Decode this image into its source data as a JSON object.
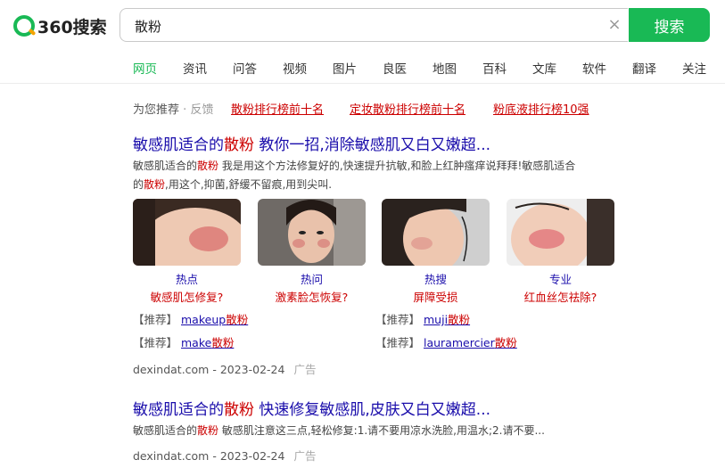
{
  "header": {
    "logo_text": "360搜索",
    "search_value": "散粉",
    "search_button": "搜索",
    "clear_symbol": "×"
  },
  "tabs": [
    "网页",
    "资讯",
    "问答",
    "视频",
    "图片",
    "良医",
    "地图",
    "百科",
    "文库",
    "软件",
    "翻译",
    "关注"
  ],
  "recommend": {
    "label": "为您推荐",
    "sep": "·",
    "feedback": "反馈",
    "links": [
      "散粉排行榜前十名",
      "定妆散粉排行榜前十名",
      "粉底液排行榜10强"
    ]
  },
  "result1": {
    "title_pre": "敏感肌适合的",
    "title_hl": "散粉",
    "title_post": " 教你一招,消除敏感肌又白又嫩超...",
    "line1_pre": "敏感肌适合的",
    "line1_hl": "散粉",
    "line1_post": " 我是用这个方法修复好的,快速提升抗敏,和脸上红肿瘙痒说拜拜!敏感肌适合",
    "line2_pre": "的",
    "line2_hl": "散粉",
    "line2_post": ",用这个,抑菌,舒缓不留痕,用到尖叫.",
    "thumbs": [
      {
        "cat": "热点",
        "q": "敏感肌怎修复?"
      },
      {
        "cat": "热问",
        "q": "激素脸怎恢复?"
      },
      {
        "cat": "热搜",
        "q": "屏障受损"
      },
      {
        "cat": "专业",
        "q": "红血丝怎祛除?"
      }
    ],
    "tuijian": [
      {
        "label": "【推荐】",
        "pre": "makeup",
        "hl": "散粉"
      },
      {
        "label": "【推荐】",
        "pre": "make",
        "hl": "散粉"
      },
      {
        "label": "【推荐】",
        "pre": "muji",
        "hl": "散粉"
      },
      {
        "label": "【推荐】",
        "pre": "lauramercier",
        "hl": "散粉"
      }
    ],
    "source": "dexindat.com - 2023-02-24",
    "ad": "广告"
  },
  "result2": {
    "title_pre": "敏感肌适合的",
    "title_hl": "散粉",
    "title_post": " 快速修复敏感肌,皮肤又白又嫩超...",
    "line1_pre": "敏感肌适合的",
    "line1_hl": "散粉",
    "line1_post": " 敏感肌注意这三点,轻松修复:1.请不要用凉水洗脸,用温水;2.请不要...",
    "source": "dexindat.com - 2023-02-24",
    "ad": "广告"
  },
  "colors": {
    "brand": "#19b955",
    "link": "#1a0dab",
    "highlight": "#cc0000"
  }
}
